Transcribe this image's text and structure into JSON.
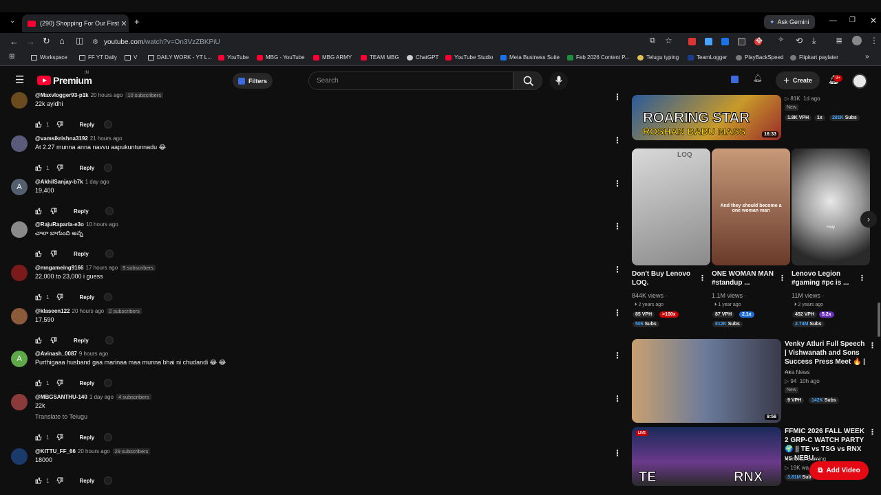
{
  "browser": {
    "tab_title": "(290) Shopping For Our First Ini",
    "url_host": "youtube.com",
    "url_path": "/watch?v=On3VzZBKPiU",
    "ask_gemini": "Ask Gemini",
    "bookmarks": [
      "Workspace",
      "FF YT Daily",
      "V",
      "DAILY WORK - YT L...",
      "YouTube",
      "MBG - YouTube",
      "MBG ARMY",
      "TEAM MBG",
      "ChatGPT",
      "YouTube Studio",
      "Meta Business Suite",
      "Feb 2026 Content P...",
      "Telugu typing",
      "TeamLogger",
      "PlayBackSpeed",
      "Flipkart paylater"
    ]
  },
  "header": {
    "logo": "Premium",
    "region": "IN",
    "filters": "Filters",
    "search_placeholder": "Search",
    "create": "Create",
    "notif_count": "9+"
  },
  "comments": [
    {
      "user": "@Maxvlogger93-p1k",
      "time": "20 hours ago",
      "subs": "10 subscribers",
      "text": "22k ayidhi",
      "likes": "1",
      "reply": "Reply",
      "avatar_color": "#6b4a1e",
      "avatar_letter": ""
    },
    {
      "user": "@vamsikrishna3192",
      "time": "21 hours ago",
      "subs": "",
      "text": "At 2.27 munna anna navvu aapukuntunnadu 😂",
      "likes": "1",
      "reply": "Reply",
      "avatar_color": "#5a5a7a",
      "avatar_letter": ""
    },
    {
      "user": "@AkhilSanjay-b7k",
      "time": "1 day ago",
      "subs": "",
      "text": "19,400",
      "likes": "",
      "reply": "Reply",
      "avatar_color": "#52606d",
      "avatar_letter": "A"
    },
    {
      "user": "@RajuRaparla-e3o",
      "time": "10 hours ago",
      "subs": "",
      "text": "చాలా బాగుంది అన్న",
      "likes": "",
      "reply": "Reply",
      "avatar_color": "#8a8a8a",
      "avatar_letter": ""
    },
    {
      "user": "@mngameing9166",
      "time": "17 hours ago",
      "subs": "9 subscribers",
      "text": "22,000 to 23,000 i guess",
      "likes": "1",
      "reply": "Reply",
      "avatar_color": "#7a1a1a",
      "avatar_letter": ""
    },
    {
      "user": "@klaseen122",
      "time": "20 hours ago",
      "subs": "2 subscribers",
      "text": "17,590",
      "likes": "",
      "reply": "Reply",
      "avatar_color": "#8a5a3a",
      "avatar_letter": ""
    },
    {
      "user": "@Avinash_0087",
      "time": "9 hours ago",
      "subs": "",
      "text": "Purthigaaa husband gaa marinaa maa munna bhai ni chudandi 😂 😂",
      "likes": "1",
      "reply": "Reply",
      "avatar_color": "#5fa84a",
      "avatar_letter": "A"
    },
    {
      "user": "@MBGSANTHU-140",
      "time": "1 day ago",
      "subs": "4 subscribers",
      "text": "22k",
      "translate": "Translate to Telugu",
      "likes": "1",
      "reply": "Reply",
      "avatar_color": "#8a3a3a",
      "avatar_letter": ""
    },
    {
      "user": "@KITTU_FF_66",
      "time": "20 hours ago",
      "subs": "29 subscribers",
      "text": "18000",
      "likes": "1",
      "reply": "Reply",
      "avatar_color": "#1a3a6a",
      "avatar_letter": ""
    }
  ],
  "sidebar": {
    "top_video": {
      "thumb_text_1": "ROARING STAR",
      "thumb_text_2": "ROSHAN BABU MASS",
      "duration": "16:33",
      "views": "81K",
      "age": "1d ago",
      "new": "New",
      "vph": "1.8K VPH",
      "mult": "1x",
      "subs": "281K",
      "subs_suffix": "Subs"
    },
    "shorts": [
      {
        "title": "Don't Buy Lenovo LOQ.",
        "views": "844K views ·",
        "age": "2 years ago",
        "vph": "85 VPH",
        "mult": ">100x",
        "subs": "506",
        "subs_suffix": "Subs",
        "thumb_text": "LOQ"
      },
      {
        "title": "ONE WOMAN MAN #standup ...",
        "views": "1.1M views ·",
        "age": "1 year ago",
        "vph": "87 VPH",
        "mult": "2.1x",
        "subs": "812K",
        "subs_suffix": "Subs",
        "thumb_text": "And they should become a one woman man"
      },
      {
        "title": "Lenovo Legion #gaming #pc is ...",
        "views": "11M views ·",
        "age": "2 years ago",
        "vph": "452 VPH",
        "mult": "5.2x",
        "subs": "2.74M",
        "subs_suffix": "Subs",
        "thumb_text": "Holy"
      }
    ],
    "video2": {
      "title": "Venky Atluri Full Speech | Vishwanath and Sons Success Press Meet 🔥 | ...",
      "channel": "Aira News",
      "views": "94",
      "age": "10h ago",
      "new": "New",
      "vph": "9 VPH",
      "subs": "142K",
      "subs_suffix": "Subs",
      "duration": "9:58"
    },
    "video3": {
      "title": "FFMIC 2026 FALL WEEK 2 GRP-C WATCH PARTY 🌍 || TE vs TSG vs RNX vs NEBU...",
      "channel": "Nonstop Gaming",
      "views": "19K wa",
      "subs": "3.81M",
      "subs_suffix": "Sub",
      "live": "LIVE",
      "thumb_left": "TE",
      "thumb_right": "RNX"
    },
    "add_video": "Add Video"
  }
}
